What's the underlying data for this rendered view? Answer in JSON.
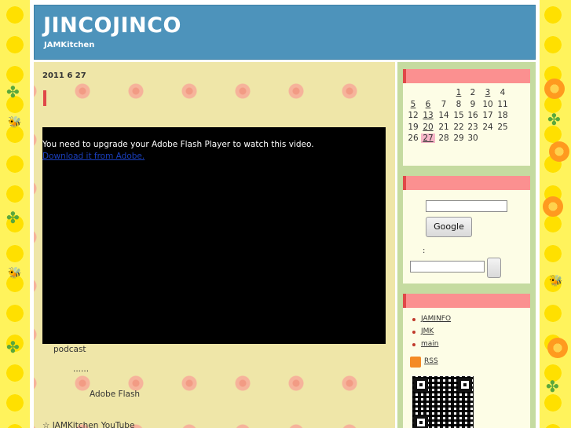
{
  "site": {
    "title": "JINCOJINCO",
    "subtitle": "JAMKitchen"
  },
  "post": {
    "date": "2011  6  27",
    "flash_message": "You need to upgrade your Adobe Flash Player to watch this video.",
    "flash_link": "Download it from Adobe.",
    "lines": [
      "podcast",
      "......",
      "Adobe Flash",
      "☆ JAMKitchen YouTube"
    ]
  },
  "calendar": {
    "rows": [
      [
        "",
        "",
        "",
        "1",
        "2",
        "3",
        "4"
      ],
      [
        "5",
        "6",
        "7",
        "8",
        "9",
        "10",
        "11"
      ],
      [
        "12",
        "13",
        "14",
        "15",
        "16",
        "17",
        "18"
      ],
      [
        "19",
        "20",
        "21",
        "22",
        "23",
        "24",
        "25"
      ],
      [
        "26",
        "27",
        "28",
        "29",
        "30",
        "",
        ""
      ]
    ],
    "linked_days": [
      "1",
      "3",
      "5",
      "6",
      "13",
      "20",
      "27"
    ],
    "today": "27"
  },
  "search": {
    "google_label": "Google",
    "colon_label": ":"
  },
  "links": {
    "items": [
      "JAMINFO",
      "JMK",
      "main"
    ],
    "rss_label": "RSS"
  },
  "colors": {
    "header": "#4d93bb",
    "main_bg": "#efe6a8",
    "sidebar_bg": "#c5dba0",
    "widget_head": "#fb9090",
    "accent_red": "#e04848",
    "today_highlight": "#f6b6c8"
  }
}
